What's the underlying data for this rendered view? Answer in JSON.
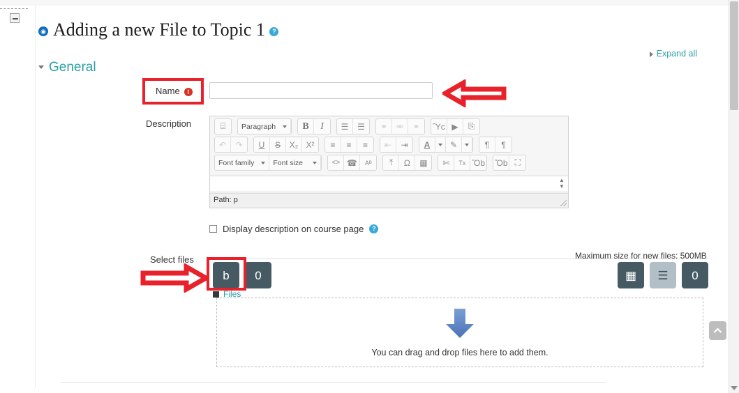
{
  "header": {
    "title": "Adding a new File to Topic 1",
    "title_badge": "icon",
    "help_label": "?",
    "expand_all": "Expand all",
    "section_general": "General"
  },
  "form": {
    "name_label": "Name",
    "name_required_mark": "!",
    "name_value": "",
    "description_label": "Description",
    "display_description_label": "Display description on course page",
    "display_description_checked": false,
    "select_files_label": "Select files",
    "max_size_text": "Maximum size for new files: 500MB"
  },
  "editor": {
    "path_status": "Path: p",
    "row1": [
      {
        "name": "accessibility-checker-icon",
        "glyph": "⌸"
      },
      {
        "name": "paragraph-style-select",
        "label": "Paragraph",
        "type": "select"
      },
      {
        "name": "bold-icon",
        "glyph": "B"
      },
      {
        "name": "italic-icon",
        "glyph": "I"
      },
      {
        "name": "bullet-list-icon",
        "glyph": "☰"
      },
      {
        "name": "numbered-list-icon",
        "glyph": "☰"
      },
      {
        "name": "link-icon",
        "glyph": "⚭",
        "dim": true
      },
      {
        "name": "unlink-icon",
        "glyph": "⚮",
        "dim": true
      },
      {
        "name": "anchor-icon",
        "glyph": "⚭",
        "dim": true
      },
      {
        "name": "insert-image-icon",
        "glyph": "Ὓc"
      },
      {
        "name": "insert-media-icon",
        "glyph": "▶"
      },
      {
        "name": "manage-files-icon",
        "glyph": "⎘"
      }
    ],
    "row2": [
      {
        "name": "undo-icon",
        "glyph": "↶",
        "dim": true
      },
      {
        "name": "redo-icon",
        "glyph": "↷",
        "dim": true
      },
      {
        "name": "underline-icon",
        "glyph": "U"
      },
      {
        "name": "strikethrough-icon",
        "glyph": "S"
      },
      {
        "name": "subscript-icon",
        "glyph": "X₂"
      },
      {
        "name": "superscript-icon",
        "glyph": "X²"
      },
      {
        "name": "align-left-icon",
        "glyph": "≡"
      },
      {
        "name": "align-center-icon",
        "glyph": "≡"
      },
      {
        "name": "align-right-icon",
        "glyph": "≡"
      },
      {
        "name": "outdent-icon",
        "glyph": "⇤",
        "dim": true
      },
      {
        "name": "indent-icon",
        "glyph": "⇥"
      },
      {
        "name": "text-color-icon",
        "glyph": "A"
      },
      {
        "name": "highlight-color-icon",
        "glyph": "✎"
      },
      {
        "name": "ltr-direction-icon",
        "glyph": "¶"
      },
      {
        "name": "rtl-direction-icon",
        "glyph": "¶"
      }
    ],
    "row3": [
      {
        "name": "font-family-select",
        "label": "Font family",
        "type": "select"
      },
      {
        "name": "font-size-select",
        "label": "Font size",
        "type": "select"
      },
      {
        "name": "html-source-icon",
        "glyph": "<>"
      },
      {
        "name": "find-replace-icon",
        "glyph": "☎"
      },
      {
        "name": "spellcheck-icon",
        "glyph": "Aᴮ"
      },
      {
        "name": "insert-horizontal-rule-icon",
        "glyph": "⤒"
      },
      {
        "name": "special-character-icon",
        "glyph": "Ω"
      },
      {
        "name": "insert-table-icon",
        "glyph": "▦"
      },
      {
        "name": "clear-formatting-icon",
        "glyph": "✄"
      },
      {
        "name": "remove-format-icon",
        "glyph": "Tx"
      },
      {
        "name": "paste-text-icon",
        "glyph": "Ὄb"
      },
      {
        "name": "paste-word-icon",
        "glyph": "Ὄb"
      },
      {
        "name": "fullscreen-icon",
        "glyph": "⛶"
      }
    ]
  },
  "filemanager": {
    "breadcrumb_label": "Files",
    "dropzone_text": "You can drag and drop files here to add them.",
    "left_buttons": [
      {
        "name": "add-file-button",
        "glyph": "὜b"
      },
      {
        "name": "create-folder-button",
        "glyph": "὜0"
      }
    ],
    "right_buttons": [
      {
        "name": "view-icons-button",
        "glyph": "▦",
        "selected": false
      },
      {
        "name": "view-list-button",
        "glyph": "☰",
        "selected": true
      },
      {
        "name": "view-tree-button",
        "glyph": "὜0",
        "selected": false
      }
    ]
  },
  "annotations": {
    "arrow_color": "#e8222a",
    "highlight_color": "#e8222a",
    "arrow_left_name": "annotation-arrow-pointing-to-name-field",
    "arrow_right_name": "annotation-arrow-pointing-to-add-file-button"
  },
  "misc": {
    "scroll_top_label": "▲"
  }
}
